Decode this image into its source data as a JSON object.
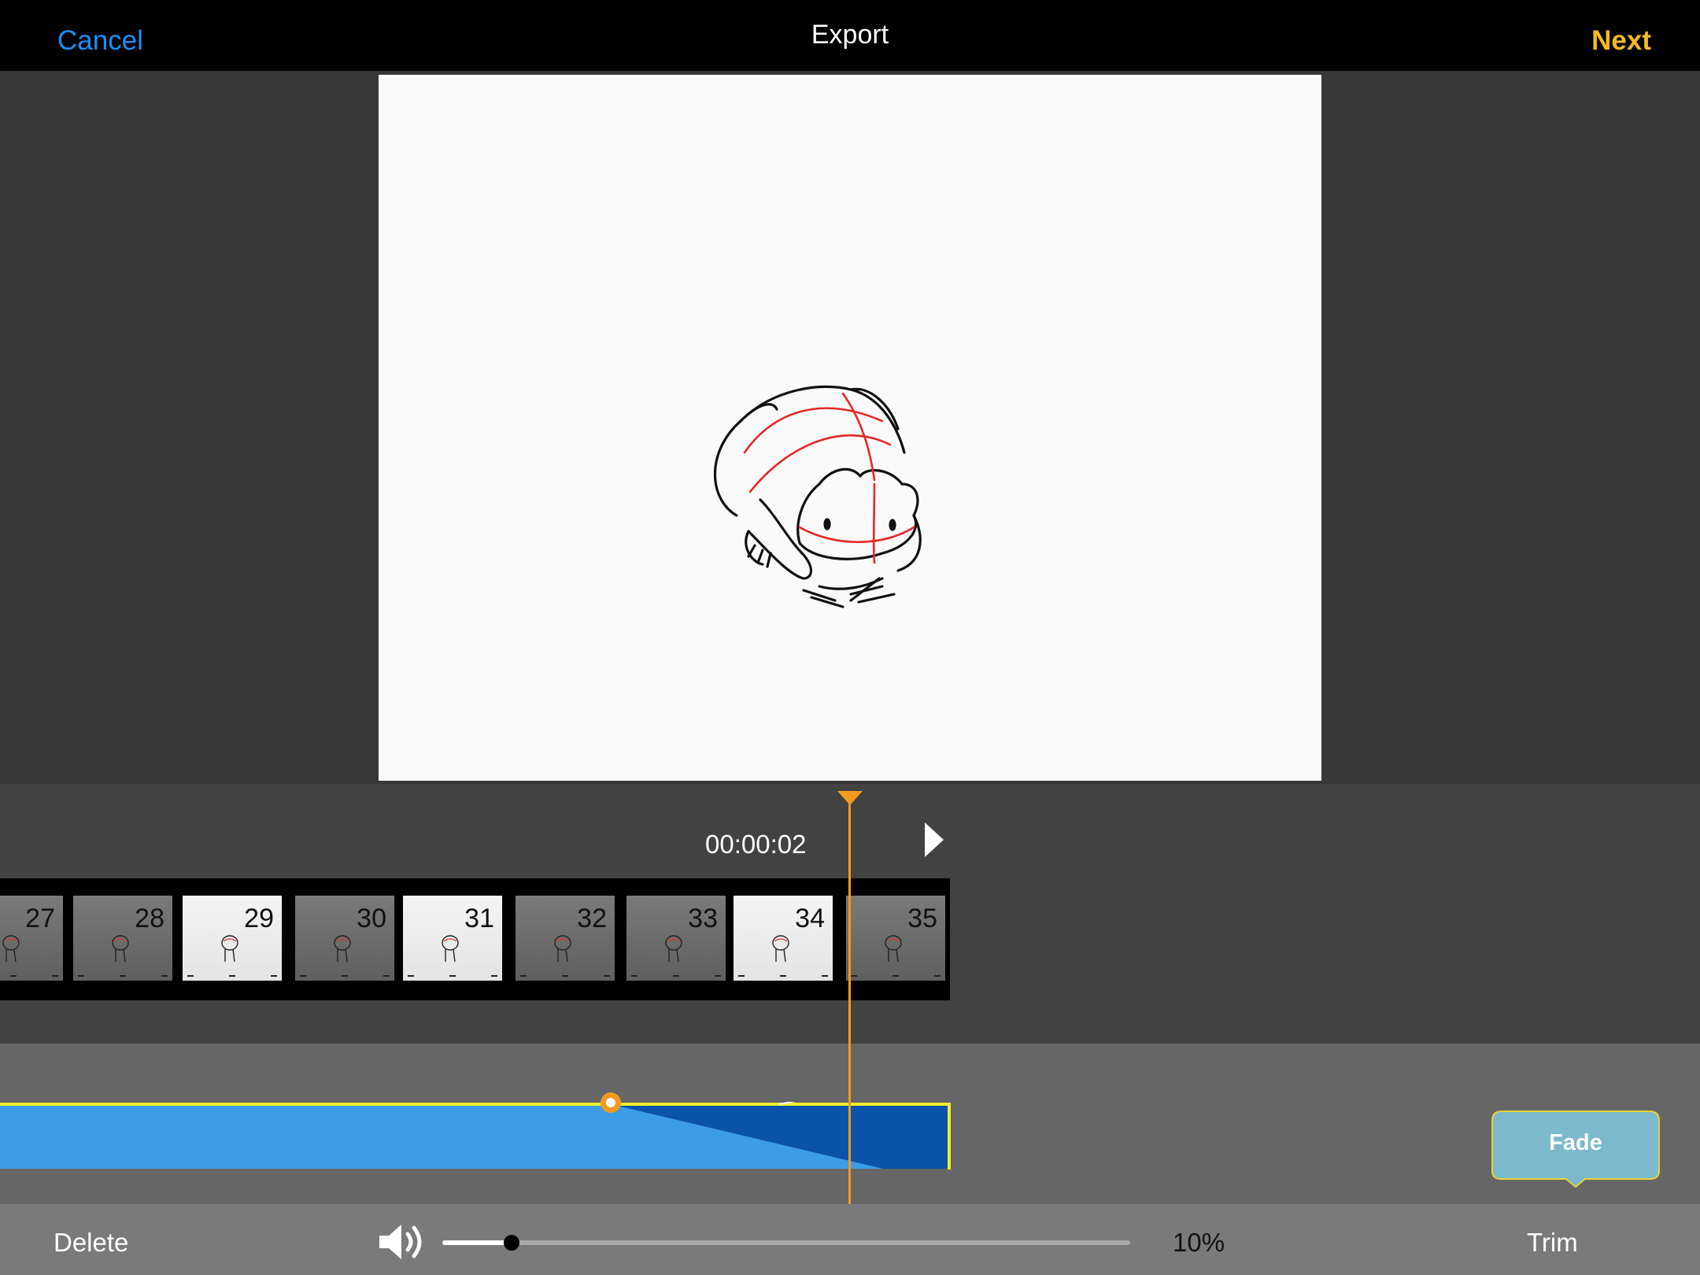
{
  "header": {
    "cancel_label": "Cancel",
    "title": "Export",
    "next_label": "Next"
  },
  "timeline": {
    "timecode": "00:00:02",
    "frames": [
      {
        "number": "27",
        "tone": "dark"
      },
      {
        "number": "28",
        "tone": "dark"
      },
      {
        "number": "29",
        "tone": "light"
      },
      {
        "number": "30",
        "tone": "dark"
      },
      {
        "number": "31",
        "tone": "light"
      },
      {
        "number": "32",
        "tone": "dark"
      },
      {
        "number": "33",
        "tone": "dark"
      },
      {
        "number": "34",
        "tone": "light"
      },
      {
        "number": "35",
        "tone": "dark"
      }
    ]
  },
  "audio": {
    "fade_label": "Fade"
  },
  "footer": {
    "delete_label": "Delete",
    "trim_label": "Trim",
    "volume_percent": "10%",
    "volume_level": 0.1
  },
  "colors": {
    "accent_blue": "#1a8ff5",
    "accent_yellow": "#f5b921",
    "playhead": "#f39a1e",
    "audio_light": "#3c9ce8",
    "audio_dark": "#0b52aa",
    "fade_button": "#7cb9cc"
  },
  "icons": {
    "play": "play-icon",
    "speaker": "speaker-icon",
    "playhead": "playhead-marker-icon"
  }
}
